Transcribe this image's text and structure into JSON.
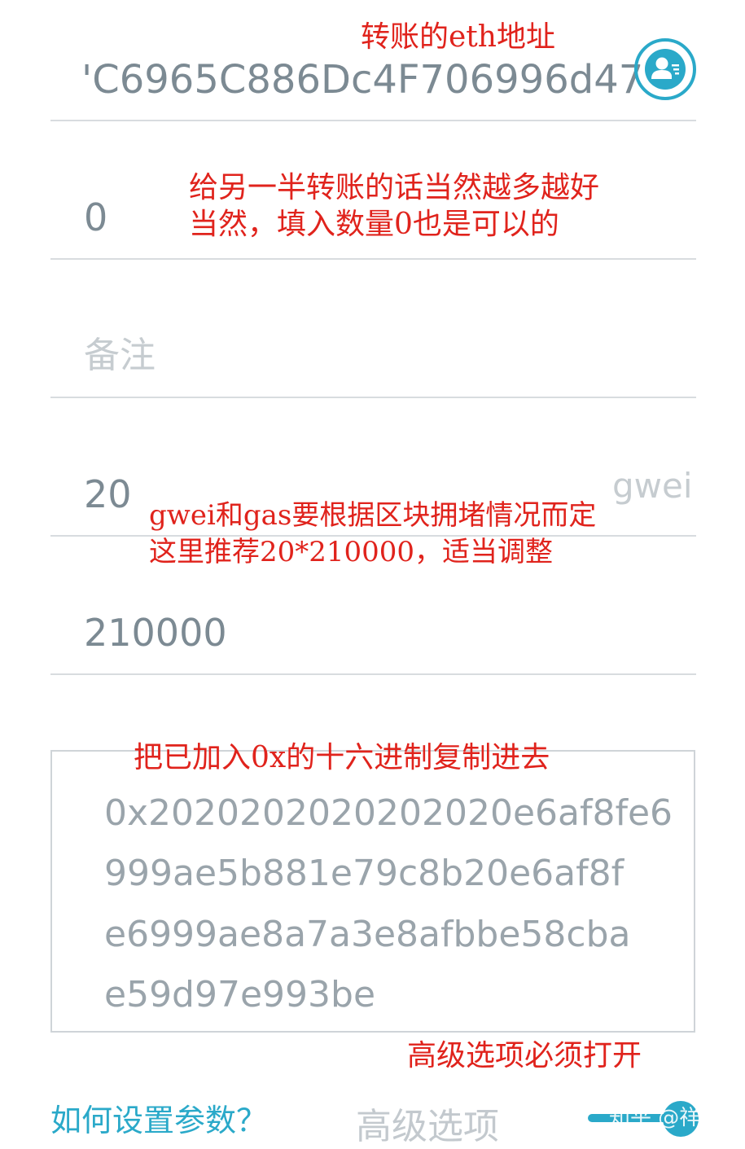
{
  "form": {
    "address": "'C6965C886Dc4F706996d47",
    "amount": "0",
    "note_placeholder": "备注",
    "gas_price": "20",
    "gas_price_unit": "gwei",
    "gas_limit": "210000",
    "data_lines": [
      "0x2020202020202020e6af8fe6",
      "999ae5b881e79c8b20e6af8f",
      "e6999ae8a7a3e8afbbe58cba",
      "e59d97e993be"
    ]
  },
  "footer": {
    "help_link": "如何设置参数？",
    "advanced_label": "高级选项",
    "advanced_enabled": true
  },
  "annotations": {
    "address_note": "转账的eth地址",
    "amount_note_line1": "给另一半转账的话当然越多越好",
    "amount_note_line2": "当然，填入数量0也是可以的",
    "gas_note_line1": "gwei和gas要根据区块拥堵情况而定",
    "gas_note_line2": "这里推荐20*210000，适当调整",
    "data_note": "把已加入0x的十六进制复制进去",
    "advanced_note": "高级选项必须打开"
  },
  "watermark": "知乎 @祥忠",
  "colors": {
    "accent": "#2aa9c9",
    "annotation": "#e0231c",
    "field_text": "#7c8a93"
  }
}
